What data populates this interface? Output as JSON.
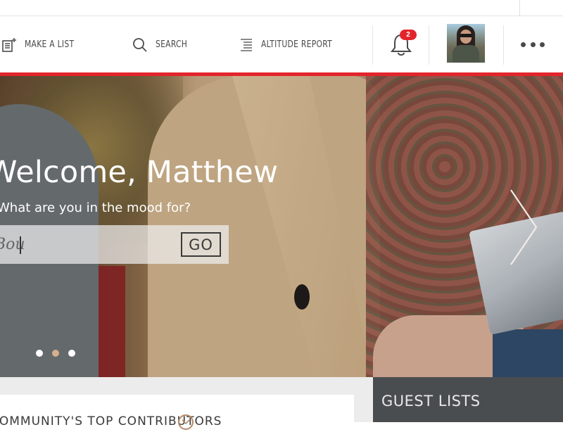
{
  "nav": {
    "items": [
      {
        "label": "MAKE A LIST",
        "icon": "make-list-icon"
      },
      {
        "label": "SEARCH",
        "icon": "search-icon"
      },
      {
        "label": "ALTITUDE REPORT",
        "icon": "altitude-report-icon"
      }
    ],
    "notifications": {
      "icon": "bell-icon",
      "count": "2"
    },
    "avatar": {
      "icon": "user-avatar"
    },
    "more": {
      "icon": "more-dots-icon"
    },
    "accent_color": "#e3242b"
  },
  "hero": {
    "welcome": "Welcome, Matthew",
    "prompt": "What are you in the mood for?",
    "search": {
      "value": "Bou",
      "placeholder": ""
    },
    "go_label": "GO",
    "next_icon": "chevron-right-icon",
    "carousel": {
      "count": 3,
      "active_index": 1
    }
  },
  "sections": {
    "contributors_title": "COMMUNITY'S TOP CONTRIBUTORS",
    "guest_lists_title": "GUEST LISTS"
  }
}
